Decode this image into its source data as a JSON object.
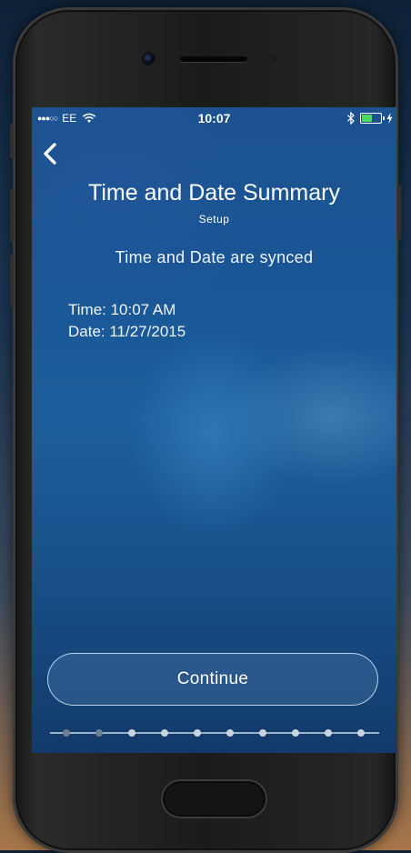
{
  "status_bar": {
    "signal": "●●●○○",
    "carrier": "EE",
    "time": "10:07"
  },
  "header": {
    "back_icon": "chevron-left-icon",
    "title": "Time and Date Summary",
    "subtitle": "Setup"
  },
  "main": {
    "sync_status": "Time and Date are synced",
    "time_line": "Time: 10:07 AM",
    "date_line": "Date: 11/27/2015"
  },
  "footer": {
    "continue_label": "Continue",
    "progress": {
      "total_steps": 10,
      "completed_steps": 2
    }
  },
  "colors": {
    "screen_blue": "#1c5f9c",
    "battery_green": "#4cd964",
    "dot_done": "#6e7f90",
    "dot_pending": "#c9d4de"
  }
}
